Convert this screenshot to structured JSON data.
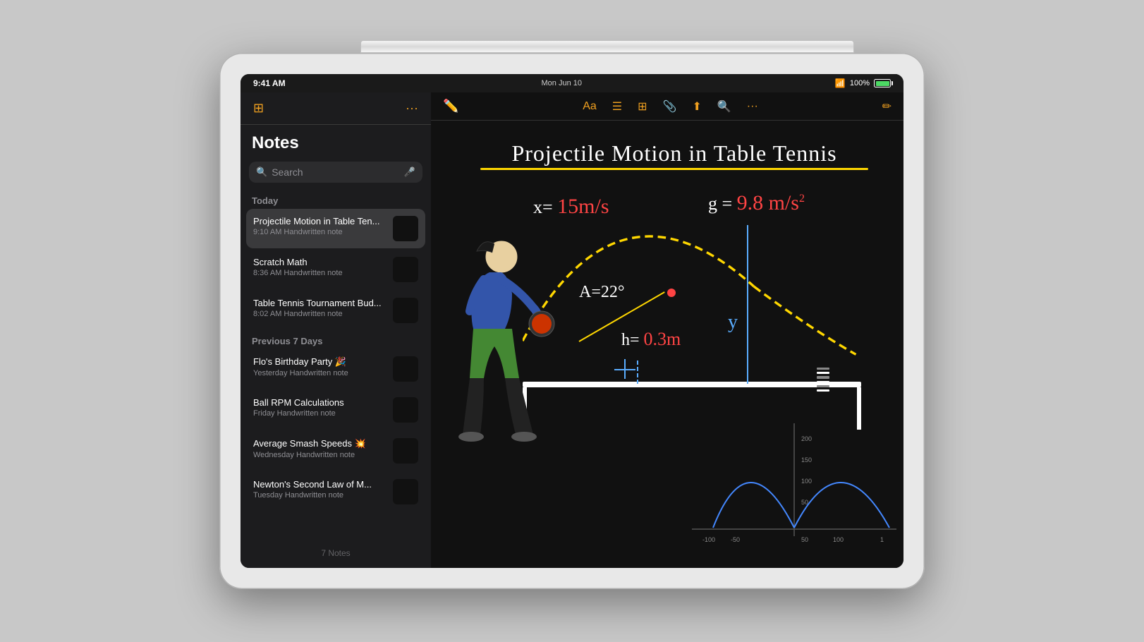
{
  "device": {
    "time": "9:41 AM",
    "date": "Mon Jun 10",
    "battery_pct": "100%",
    "wifi": true
  },
  "sidebar": {
    "title": "Notes",
    "search_placeholder": "Search",
    "sections": [
      {
        "label": "Today",
        "notes": [
          {
            "title": "Projectile Motion in Table Ten...",
            "meta": "9:10 AM  Handwritten note",
            "active": true
          },
          {
            "title": "Scratch Math",
            "meta": "8:36 AM  Handwritten note",
            "active": false
          },
          {
            "title": "Table Tennis Tournament Bud...",
            "meta": "8:02 AM  Handwritten note",
            "active": false
          }
        ]
      },
      {
        "label": "Previous 7 Days",
        "notes": [
          {
            "title": "Flo's Birthday Party 🎉",
            "meta": "Yesterday  Handwritten note",
            "active": false
          },
          {
            "title": "Ball RPM Calculations",
            "meta": "Friday  Handwritten note",
            "active": false
          },
          {
            "title": "Average Smash Speeds 💥",
            "meta": "Wednesday  Handwritten note",
            "active": false
          },
          {
            "title": "Newton's Second Law of M...",
            "meta": "Tuesday  Handwritten note",
            "active": false
          }
        ]
      }
    ],
    "notes_count": "7 Notes"
  },
  "note": {
    "title": "Projectile Motion in Table Tennis",
    "formula_x": "x= 15m/s",
    "formula_g": "g = 9.8 m/s²",
    "formula_a": "A=22°",
    "formula_h": "h= 0.3m",
    "formula_y": "y"
  },
  "toolbar": {
    "more_dots": "···",
    "more_dots2": "···"
  }
}
